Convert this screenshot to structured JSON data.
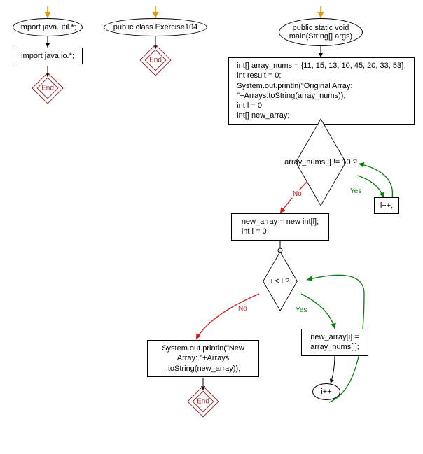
{
  "chart_data": {
    "type": "flowchart",
    "nodes": [
      {
        "id": "n_import1",
        "shape": "ellipse",
        "text": "import java.util.*;"
      },
      {
        "id": "n_import2",
        "shape": "rect",
        "text": "import java.io.*;"
      },
      {
        "id": "n_end1",
        "shape": "end",
        "text": "End"
      },
      {
        "id": "n_class",
        "shape": "ellipse",
        "text": "public class Exercise104"
      },
      {
        "id": "n_end2",
        "shape": "end",
        "text": "End"
      },
      {
        "id": "n_main",
        "shape": "ellipse",
        "text": "public static void\nmain(String[] args)"
      },
      {
        "id": "n_init",
        "shape": "rect",
        "text": "int[] array_nums = {11, 15, 13, 10, 45, 20, 33, 53};\nint result = 0;\nSystem.out.println(\"Original Array:\n\"+Arrays.toString(array_nums));\nint l = 0;\nint[] new_array;"
      },
      {
        "id": "n_cond1",
        "shape": "diamond",
        "text": "array_nums[l] != 10 ?"
      },
      {
        "id": "n_lpp",
        "shape": "rect",
        "text": "l++;"
      },
      {
        "id": "n_newarr",
        "shape": "rect",
        "text": "new_array = new int[l];\nint i = 0"
      },
      {
        "id": "n_cond2",
        "shape": "diamond",
        "text": "i < l ?"
      },
      {
        "id": "n_assign",
        "shape": "rect",
        "text": "new_array[i] =\narray_nums[i];"
      },
      {
        "id": "n_ipp",
        "shape": "ellipse",
        "text": "i++"
      },
      {
        "id": "n_print",
        "shape": "rect",
        "text": "System.out.println(\"New\nArray: \"+Arrays\n.toString(new_array));"
      },
      {
        "id": "n_end3",
        "shape": "end",
        "text": "End"
      }
    ],
    "edges": [
      {
        "from": "start1",
        "to": "n_import1",
        "color": "orange"
      },
      {
        "from": "n_import1",
        "to": "n_import2"
      },
      {
        "from": "n_import2",
        "to": "n_end1"
      },
      {
        "from": "start2",
        "to": "n_class",
        "color": "orange"
      },
      {
        "from": "n_class",
        "to": "n_end2"
      },
      {
        "from": "start3",
        "to": "n_main",
        "color": "orange"
      },
      {
        "from": "n_main",
        "to": "n_init"
      },
      {
        "from": "n_init",
        "to": "n_cond1"
      },
      {
        "from": "n_cond1",
        "to": "n_lpp",
        "label": "Yes",
        "color": "green"
      },
      {
        "from": "n_lpp",
        "to": "n_cond1",
        "color": "green"
      },
      {
        "from": "n_cond1",
        "to": "n_newarr",
        "label": "No",
        "color": "red"
      },
      {
        "from": "n_newarr",
        "to": "n_cond2"
      },
      {
        "from": "n_cond2",
        "to": "n_assign",
        "label": "Yes",
        "color": "green"
      },
      {
        "from": "n_assign",
        "to": "n_ipp"
      },
      {
        "from": "n_ipp",
        "to": "n_cond2",
        "color": "green"
      },
      {
        "from": "n_cond2",
        "to": "n_print",
        "label": "No",
        "color": "red"
      },
      {
        "from": "n_print",
        "to": "n_end3"
      }
    ],
    "yes_label": "Yes",
    "no_label": "No"
  }
}
